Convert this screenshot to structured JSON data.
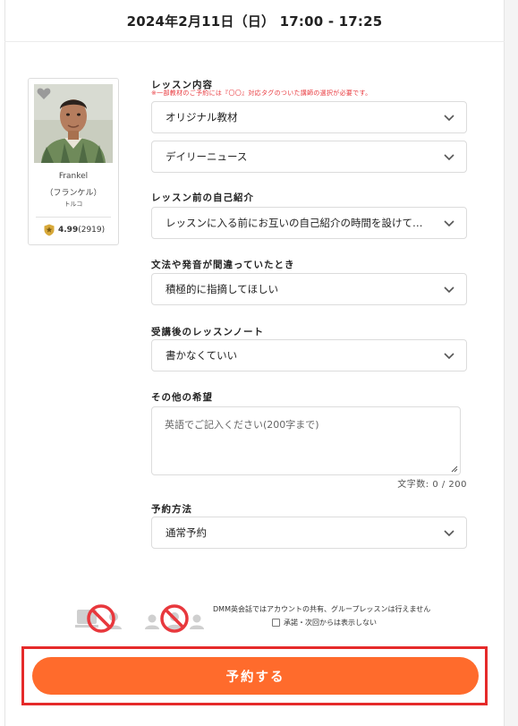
{
  "header": {
    "title": "2024年2月11日（日） 17:00 - 17:25"
  },
  "teacher": {
    "name": "Frankel",
    "kana": "（フランケル）",
    "country": "トルコ",
    "rating": "4.99",
    "review_count": "(2919)"
  },
  "form": {
    "lesson_content": {
      "label": "レッスン内容",
      "note": "※一部教材のご予約には『〇〇』対応タグのついた講師の選択が必要です。",
      "selected_1": "オリジナル教材",
      "selected_2": "デイリーニュース"
    },
    "self_intro": {
      "label": "レッスン前の自己紹介",
      "selected": "レッスンに入る前にお互いの自己紹介の時間を設けて…"
    },
    "correction": {
      "label": "文法や発音が間違っていたとき",
      "selected": "積極的に指摘してほしい"
    },
    "lesson_note": {
      "label": "受講後のレッスンノート",
      "selected": "書かなくていい"
    },
    "other_requests": {
      "label": "その他の希望",
      "placeholder": "英語でご記入ください(200字まで)",
      "char_count": "文字数: 0 / 200"
    },
    "booking_method": {
      "label": "予約方法",
      "selected": "通常予約"
    }
  },
  "notice": {
    "text": "DMM英会話ではアカウントの共有、グループレッスンは行えません",
    "agree_label": "承諾・次回からは表示しない"
  },
  "cta": {
    "label": "予約する"
  },
  "colors": {
    "accent": "#ff6b2c",
    "highlight_border": "#e52a2a",
    "warning_text": "#e8383d"
  }
}
